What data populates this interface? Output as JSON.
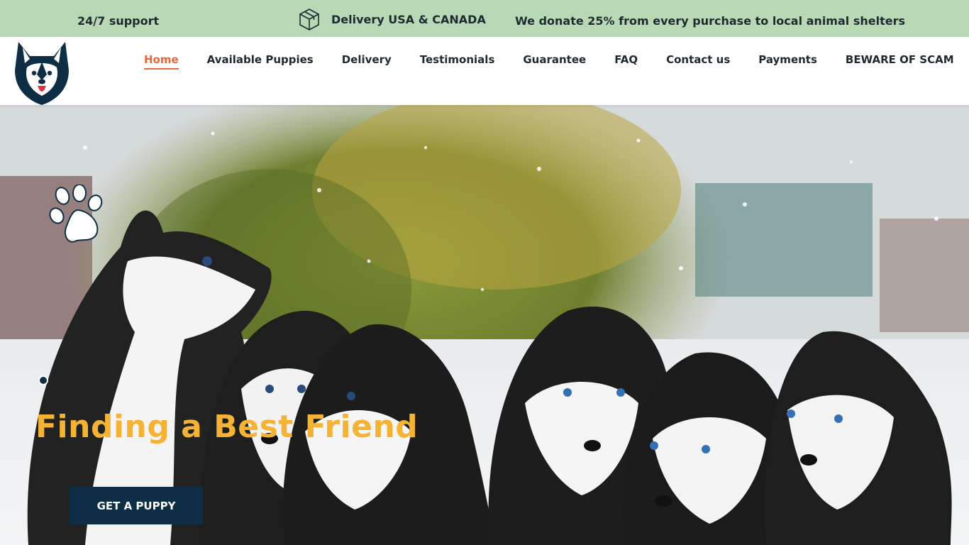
{
  "topbar": {
    "support_text": "24/7 support",
    "delivery_text": "Delivery USA & CANADA",
    "donate_text": "We donate 25% from every purchase to local animal shelters",
    "background_color": "#b7d9b5"
  },
  "header": {
    "logo_icon": "husky-logo-icon",
    "nav": [
      {
        "label": "Home",
        "active": true
      },
      {
        "label": "Available Puppies"
      },
      {
        "label": "Delivery"
      },
      {
        "label": "Testimonials"
      },
      {
        "label": "Guarantee"
      },
      {
        "label": "FAQ"
      },
      {
        "label": "Contact us"
      },
      {
        "label": "Payments"
      },
      {
        "label": "BEWARE OF SCAM"
      }
    ],
    "active_color": "#e8683e"
  },
  "hero": {
    "headline": "Finding a  Best Friend",
    "cta_label": "GET A PUPPY",
    "headline_color": "#f5b335",
    "cta_color": "#0d2e45",
    "decor_icon": "paw-print-icon",
    "image_description_icon": "husky-puppies-photo"
  }
}
